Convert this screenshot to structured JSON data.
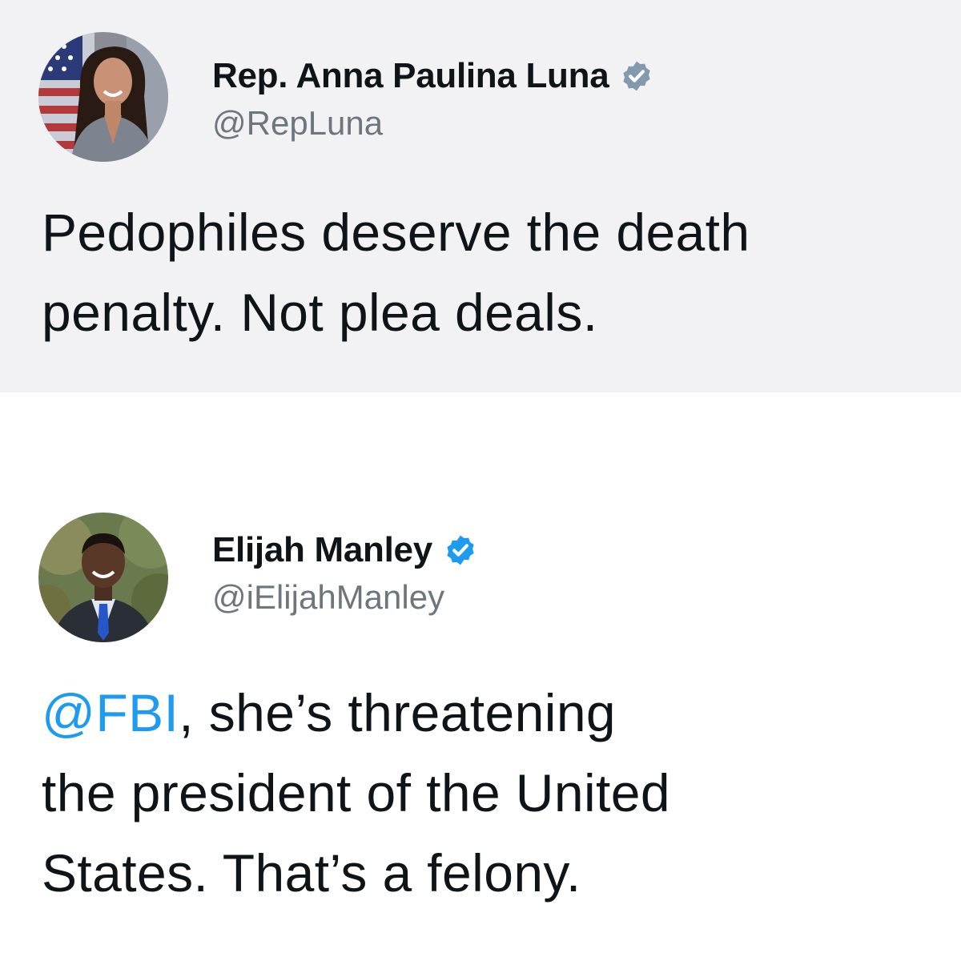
{
  "tweets": [
    {
      "display_name": "Rep. Anna Paulina Luna",
      "handle": "@RepLuna",
      "verified": true,
      "verified_badge_color": "#829aab",
      "avatar_icon": "profile-photo-flag-background",
      "text_lines": [
        "Pedophiles deserve the death",
        "penalty. Not plea deals."
      ]
    },
    {
      "display_name": "Elijah Manley",
      "handle": "@iElijahManley",
      "verified": true,
      "verified_badge_color": "#1d9bf0",
      "avatar_icon": "profile-photo-man-suit",
      "mention": "@FBI",
      "text_line1_rest": ", she’s threatening",
      "text_lines": [
        "the president of the United",
        "States. That’s a felony."
      ]
    }
  ],
  "colors": {
    "top_background": "#f2f2f4",
    "bottom_background": "#ffffff",
    "mention": "#1d9bf0",
    "handle": "#6e767d"
  }
}
